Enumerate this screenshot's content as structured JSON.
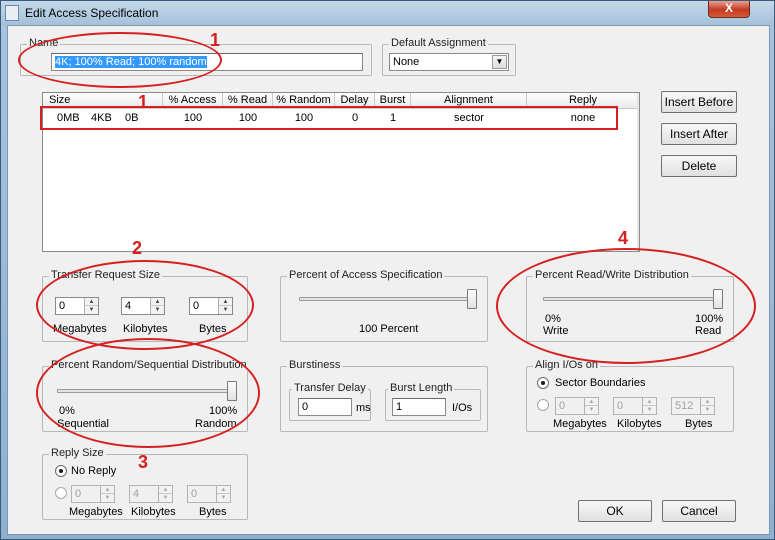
{
  "window": {
    "title": "Edit Access Specification",
    "close_label": "X"
  },
  "name_group": {
    "label": "Name",
    "value": "4K; 100% Read; 100% random"
  },
  "default_assignment": {
    "label": "Default Assignment",
    "value": "None"
  },
  "list": {
    "columns": [
      "Size",
      "% Access",
      "% Read",
      "% Random",
      "Delay",
      "Burst",
      "Alignment",
      "Reply"
    ],
    "row": {
      "size_mb": "0MB",
      "size_kb": "4KB",
      "size_b": "0B",
      "access": "100",
      "read": "100",
      "random": "100",
      "delay": "0",
      "burst": "1",
      "alignment": "sector",
      "reply": "none"
    }
  },
  "buttons": {
    "insert_before": "Insert Before",
    "insert_after": "Insert After",
    "delete": "Delete",
    "ok": "OK",
    "cancel": "Cancel"
  },
  "transfer_request_size": {
    "label": "Transfer Request Size",
    "megabytes": "0",
    "kilobytes": "4",
    "bytes": "0",
    "megabytes_label": "Megabytes",
    "kilobytes_label": "Kilobytes",
    "bytes_label": "Bytes"
  },
  "percent_access": {
    "label": "Percent of Access Specification",
    "value_text": "100 Percent",
    "value": 100
  },
  "read_write": {
    "label": "Percent Read/Write Distribution",
    "left_pct": "0%",
    "left_label": "Write",
    "right_pct": "100%",
    "right_label": "Read",
    "value": 100
  },
  "random_sequential": {
    "label": "Percent Random/Sequential Distribution",
    "left_pct": "0%",
    "left_label": "Sequential",
    "right_pct": "100%",
    "right_label": "Random",
    "value": 100
  },
  "burstiness": {
    "label": "Burstiness",
    "transfer_delay_label": "Transfer Delay",
    "transfer_delay": "0",
    "transfer_delay_unit": "ms",
    "burst_length_label": "Burst Length",
    "burst_length": "1",
    "burst_length_unit": "I/Os"
  },
  "align": {
    "label": "Align I/Os on",
    "sector_label": "Sector Boundaries",
    "megabytes": "0",
    "kilobytes": "0",
    "bytes": "512",
    "megabytes_label": "Megabytes",
    "kilobytes_label": "Kilobytes",
    "bytes_label": "Bytes"
  },
  "reply_size": {
    "label": "Reply Size",
    "no_reply_label": "No Reply",
    "megabytes": "0",
    "kilobytes": "4",
    "bytes": "0",
    "megabytes_label": "Megabytes",
    "kilobytes_label": "Kilobytes",
    "bytes_label": "Bytes"
  },
  "annotations": [
    "1",
    "1",
    "2",
    "3",
    "4"
  ],
  "colors": {
    "annotation": "#d62020",
    "selection": "#3399ff"
  }
}
